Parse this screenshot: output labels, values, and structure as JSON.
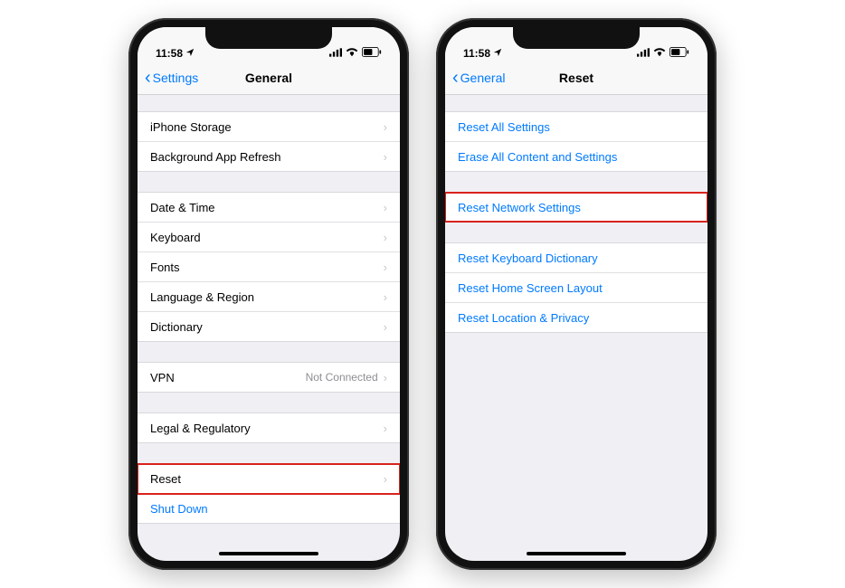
{
  "status": {
    "time": "11:58"
  },
  "left": {
    "back_label": "Settings",
    "title": "General",
    "groups": [
      {
        "rows": [
          {
            "label": "iPhone Storage",
            "chevron": true
          },
          {
            "label": "Background App Refresh",
            "chevron": true
          }
        ]
      },
      {
        "rows": [
          {
            "label": "Date & Time",
            "chevron": true
          },
          {
            "label": "Keyboard",
            "chevron": true
          },
          {
            "label": "Fonts",
            "chevron": true
          },
          {
            "label": "Language & Region",
            "chevron": true
          },
          {
            "label": "Dictionary",
            "chevron": true
          }
        ]
      },
      {
        "rows": [
          {
            "label": "VPN",
            "detail": "Not Connected",
            "chevron": true
          }
        ]
      },
      {
        "rows": [
          {
            "label": "Legal & Regulatory",
            "chevron": true
          }
        ]
      },
      {
        "rows": [
          {
            "label": "Reset",
            "chevron": true,
            "highlighted": true
          },
          {
            "label": "Shut Down",
            "link": true
          }
        ]
      }
    ]
  },
  "right": {
    "back_label": "General",
    "title": "Reset",
    "groups": [
      {
        "rows": [
          {
            "label": "Reset All Settings",
            "link": true
          },
          {
            "label": "Erase All Content and Settings",
            "link": true
          }
        ]
      },
      {
        "rows": [
          {
            "label": "Reset Network Settings",
            "link": true,
            "highlighted": true
          }
        ]
      },
      {
        "rows": [
          {
            "label": "Reset Keyboard Dictionary",
            "link": true
          },
          {
            "label": "Reset Home Screen Layout",
            "link": true
          },
          {
            "label": "Reset Location & Privacy",
            "link": true
          }
        ]
      }
    ]
  }
}
